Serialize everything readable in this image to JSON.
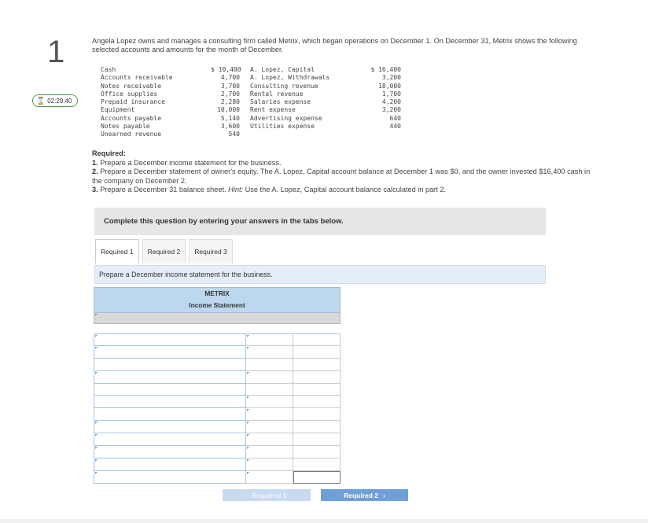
{
  "question": {
    "number": "1",
    "timer": "02:29:40",
    "intro": "Angela Lopez owns and manages a consulting firm called Metrix, which began operations on December 1. On December 31, Metrix shows the following selected accounts and amounts for the month of December."
  },
  "accounts_left": [
    {
      "name": "Cash",
      "amount": "$ 10,400"
    },
    {
      "name": "Accounts receivable",
      "amount": "4,700"
    },
    {
      "name": "Notes receivable",
      "amount": "3,700"
    },
    {
      "name": "Office supplies",
      "amount": "2,700"
    },
    {
      "name": "Prepaid insurance",
      "amount": "2,280"
    },
    {
      "name": "Equipment",
      "amount": "10,000"
    },
    {
      "name": "Accounts payable",
      "amount": "5,140"
    },
    {
      "name": "Notes payable",
      "amount": "3,600"
    },
    {
      "name": "Unearned revenue",
      "amount": "540"
    }
  ],
  "accounts_right": [
    {
      "name": "A. Lopez, Capital",
      "amount": "$ 16,400"
    },
    {
      "name": "A. Lopez, Withdrawals",
      "amount": "3,200"
    },
    {
      "name": "Consulting revenue",
      "amount": "18,000"
    },
    {
      "name": "Rental revenue",
      "amount": "1,700"
    },
    {
      "name": "Salaries expense",
      "amount": "4,200"
    },
    {
      "name": "Rent expense",
      "amount": "3,200"
    },
    {
      "name": "Advertising expense",
      "amount": "640"
    },
    {
      "name": "Utilities expense",
      "amount": "440"
    }
  ],
  "required": {
    "heading": "Required:",
    "items": [
      {
        "num": "1.",
        "text": "Prepare a December income statement for the business."
      },
      {
        "num": "2.",
        "text": "Prepare a December statement of owner's equity. The A. Lopez, Capital account balance at December 1 was $0, and the owner invested $16,400 cash in the company on December 2."
      },
      {
        "num": "3.",
        "text": "Prepare a December 31 balance sheet.",
        "hint_label": "Hint:",
        "hint": "Use the A. Lopez, Capital account balance calculated in part 2."
      }
    ]
  },
  "complete_banner": "Complete this question by entering your answers in the tabs below.",
  "tabs": [
    "Required 1",
    "Required 2",
    "Required 3"
  ],
  "prompt": "Prepare a December income statement for the business.",
  "statement": {
    "company": "METRIX",
    "title": "Income Statement"
  },
  "nav": {
    "prev": "Required 1",
    "prev_icon": "‹",
    "next": "Required 2",
    "next_icon": "›"
  }
}
